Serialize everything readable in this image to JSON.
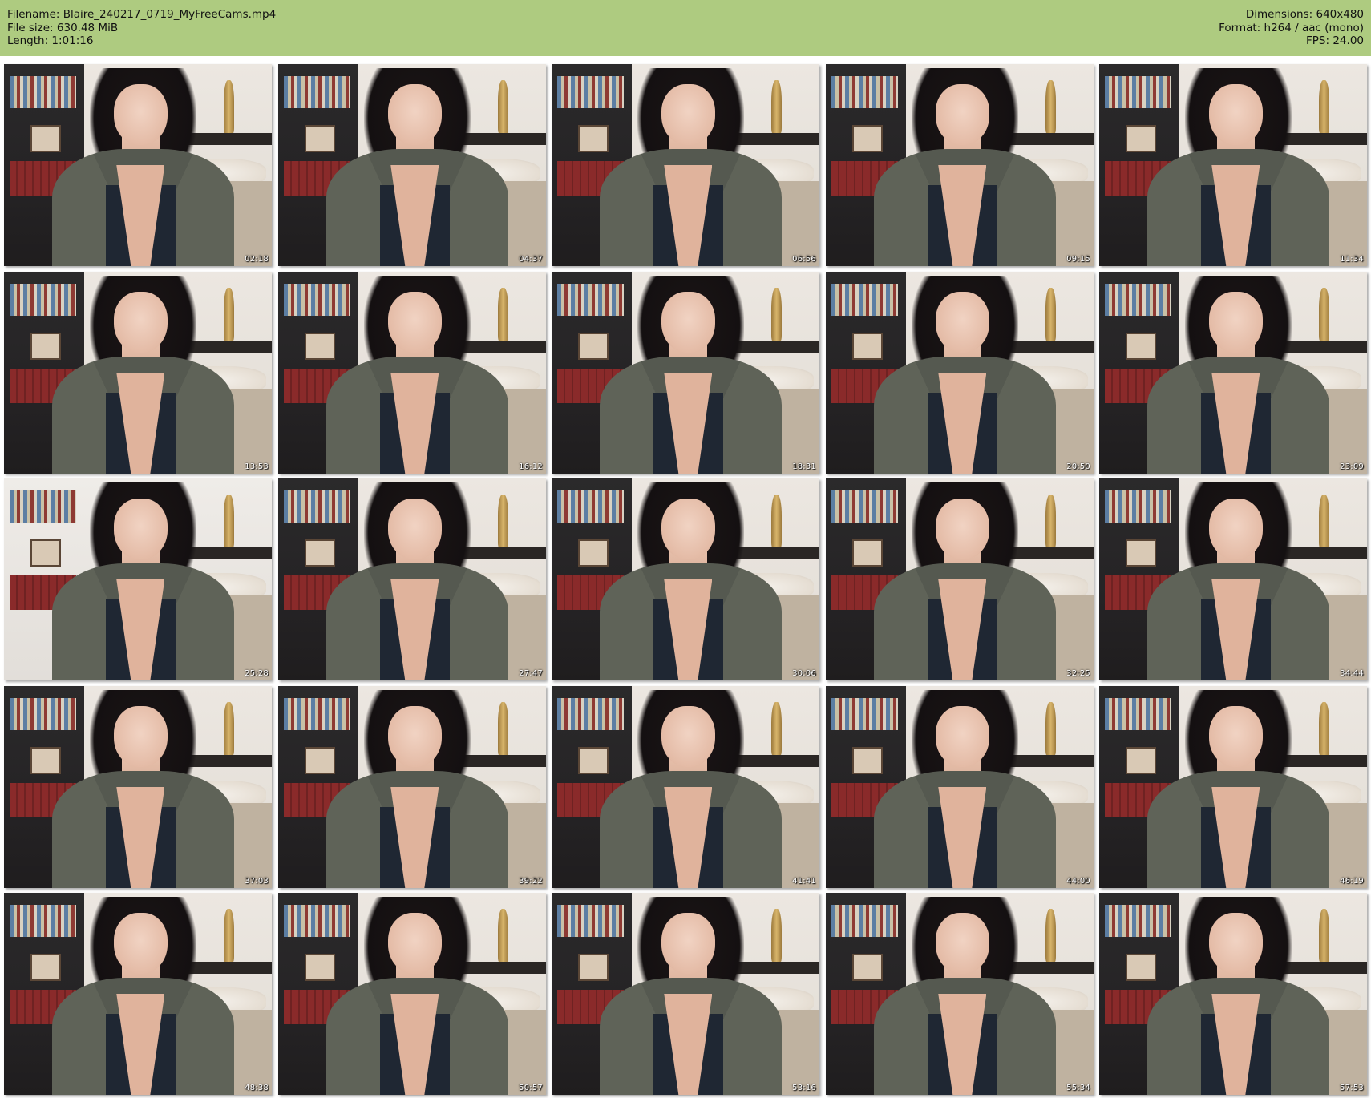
{
  "header": {
    "filename": "Filename: Blaire_240217_0719_MyFreeCams.mp4",
    "file_size": "File size: 630.48 MiB",
    "length": "Length: 1:01:16",
    "dimensions": "Dimensions: 640x480",
    "format": "Format: h264 / aac (mono)",
    "fps": "FPS: 24.00",
    "background_color": "#aecb80"
  },
  "thumbnails": [
    {
      "timestamp": "02:18"
    },
    {
      "timestamp": "04:37"
    },
    {
      "timestamp": "06:56"
    },
    {
      "timestamp": "09:15"
    },
    {
      "timestamp": "11:34"
    },
    {
      "timestamp": "13:53"
    },
    {
      "timestamp": "16:12"
    },
    {
      "timestamp": "18:31"
    },
    {
      "timestamp": "20:50"
    },
    {
      "timestamp": "23:09"
    },
    {
      "timestamp": "25:28"
    },
    {
      "timestamp": "27:47"
    },
    {
      "timestamp": "30:06"
    },
    {
      "timestamp": "32:25"
    },
    {
      "timestamp": "34:44"
    },
    {
      "timestamp": "37:03"
    },
    {
      "timestamp": "39:22"
    },
    {
      "timestamp": "41:41"
    },
    {
      "timestamp": "44:00"
    },
    {
      "timestamp": "46:19"
    },
    {
      "timestamp": "48:38"
    },
    {
      "timestamp": "50:57"
    },
    {
      "timestamp": "53:16"
    },
    {
      "timestamp": "55:34"
    },
    {
      "timestamp": "57:53"
    }
  ]
}
